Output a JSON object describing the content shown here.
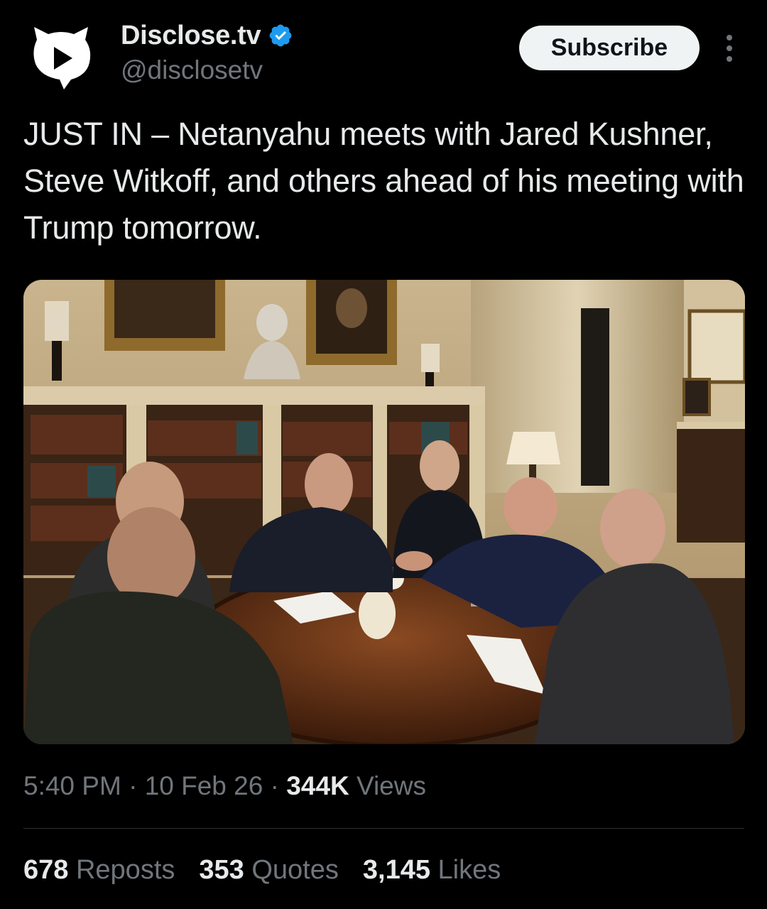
{
  "author": {
    "display_name": "Disclose.tv",
    "handle": "@disclosetv",
    "verified": true,
    "avatar_icon": "disclose-logo-icon"
  },
  "actions": {
    "subscribe_label": "Subscribe",
    "more_icon": "more-vertical-icon"
  },
  "tweet": {
    "text": "JUST IN – Netanyahu meets with Jared Kushner, Steve Witkoff, and others ahead of his meeting with Trump tomorrow."
  },
  "meta": {
    "time": "5:40 PM",
    "sep1": " · ",
    "date": "10 Feb 26",
    "sep2": " · ",
    "views_count": "344K",
    "views_label": " Views"
  },
  "stats": [
    {
      "count": "678",
      "label": "Reposts"
    },
    {
      "count": "353",
      "label": "Quotes"
    },
    {
      "count": "3,145",
      "label": "Likes"
    }
  ],
  "colors": {
    "background": "#000000",
    "primary_text": "#e7e9ea",
    "secondary_text": "#71767b",
    "verified_blue": "#1d9bf0",
    "divider": "#2f3336"
  }
}
